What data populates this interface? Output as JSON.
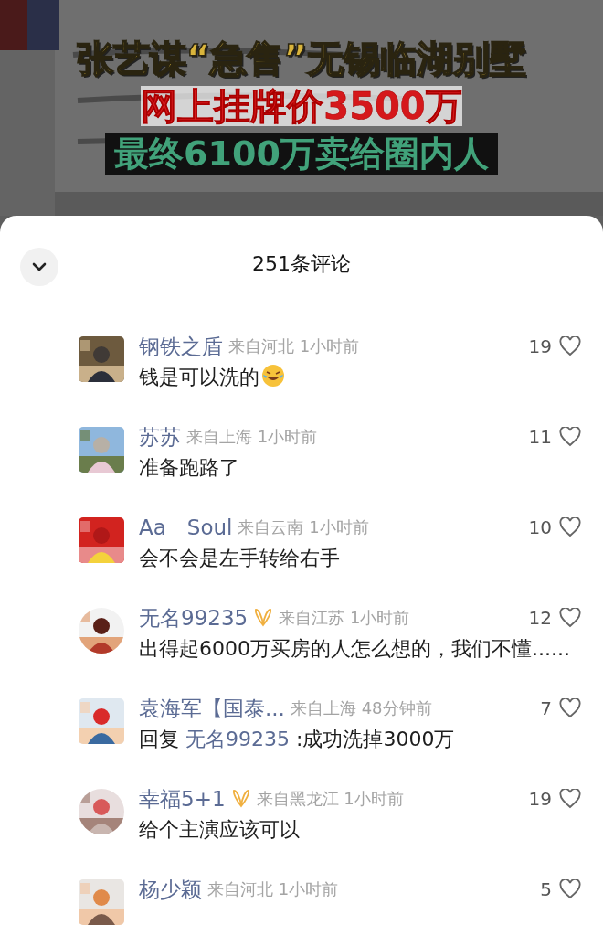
{
  "video": {
    "captions": [
      {
        "kind": "gold",
        "text": "张艺谋“急售”无锡临湖别墅"
      },
      {
        "kind": "red",
        "text": "网上挂牌价3500万"
      },
      {
        "kind": "green",
        "text": "最终6100万卖给圈内人"
      }
    ]
  },
  "sheet": {
    "title": "251条评论"
  },
  "comments": [
    {
      "name": "钢铁之盾",
      "badge": false,
      "round_avatar": false,
      "meta": "来自河北 1小时前",
      "text": "钱是可以洗的",
      "emoji": true,
      "likes": "19",
      "liked": false
    },
    {
      "name": "苏苏",
      "badge": false,
      "round_avatar": false,
      "meta": "来自上海 1小时前",
      "text": "准备跑路了",
      "emoji": false,
      "likes": "11",
      "liked": false
    },
    {
      "name": "Aa　Soul",
      "badge": false,
      "round_avatar": false,
      "meta": "来自云南 1小时前",
      "text": "会不会是左手转给右手",
      "emoji": false,
      "likes": "10",
      "liked": false
    },
    {
      "name": "无名99235",
      "badge": true,
      "round_avatar": true,
      "meta": "来自江苏 1小时前",
      "text": "出得起6000万买房的人怎么想的，我们不懂......",
      "emoji": false,
      "likes": "12",
      "liked": false
    },
    {
      "name": "袁海军【国泰...",
      "badge": false,
      "round_avatar": false,
      "meta": "来自上海 48分钟前",
      "reply_label": "回复",
      "reply_to": "无名99235",
      "text": ":成功洗掉3000万",
      "emoji": false,
      "likes": "7",
      "liked": false
    },
    {
      "name": "幸福5+1",
      "badge": true,
      "round_avatar": true,
      "meta": "来自黑龙江 1小时前",
      "text": "给个主演应该可以",
      "emoji": false,
      "likes": "19",
      "liked": false
    },
    {
      "name": "杨少颖",
      "badge": false,
      "round_avatar": false,
      "meta": "来自河北 1小时前",
      "likes": "5",
      "liked": false
    }
  ]
}
